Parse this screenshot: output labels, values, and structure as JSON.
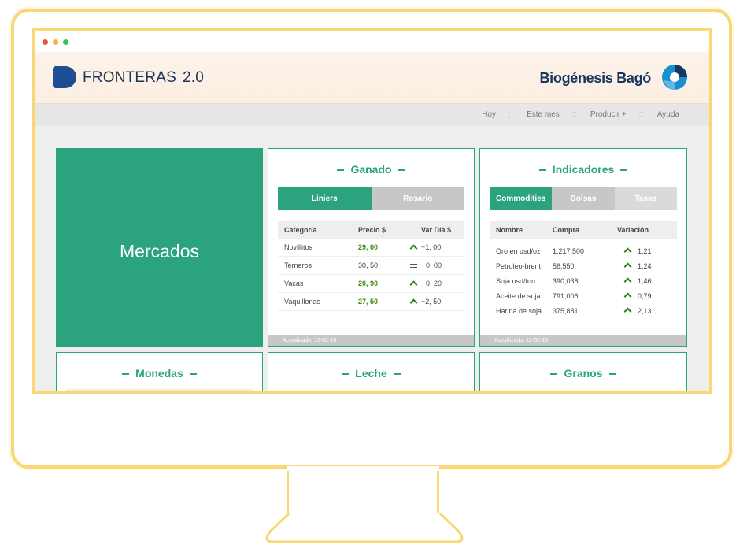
{
  "header": {
    "brand": "FRONTERAS",
    "version": "2.0",
    "partner": "Biogénesis Bagó"
  },
  "nav": [
    {
      "label": "Hoy"
    },
    {
      "label": "Este mes"
    },
    {
      "label": "Producir +"
    },
    {
      "label": "Ayuda"
    }
  ],
  "mercados": {
    "label": "Mercados"
  },
  "ganado": {
    "title": "Ganado",
    "tabs": [
      "Liniers",
      "Rosario"
    ],
    "columns": [
      "Categoría",
      "Precio $",
      "Var Día $"
    ],
    "rows": [
      {
        "cat": "Novillitos",
        "precio": "29, 00",
        "trend": "up",
        "var": "+1, 00"
      },
      {
        "cat": "Terneros",
        "precio": "30, 50",
        "trend": "equal",
        "var": "0, 00"
      },
      {
        "cat": "Vacas",
        "precio": "20, 90",
        "trend": "up",
        "var": "0, 20"
      },
      {
        "cat": "Vaquillonas",
        "precio": "27, 50",
        "trend": "up",
        "var": "+2, 50"
      }
    ],
    "updated": "Actualizado: 12-02-16"
  },
  "indicadores": {
    "title": "Indicadores",
    "tabs": [
      "Commodities",
      "Bolsas",
      "Tasas"
    ],
    "columns": [
      "Nombre",
      "Compra",
      "Variación"
    ],
    "rows": [
      {
        "nombre": "Oro en usd/oz",
        "compra": "1.217,500",
        "var": "1,21"
      },
      {
        "nombre": "Petroleo-brent",
        "compra": "56,550",
        "var": "1,24"
      },
      {
        "nombre": "Soja usd/ton",
        "compra": "390,038",
        "var": "1,46"
      },
      {
        "nombre": "Aceite de soja",
        "compra": "791,006",
        "var": "0,79"
      },
      {
        "nombre": "Harina de soja",
        "compra": "375,881",
        "var": "2,13"
      }
    ],
    "updated": "Actualizado: 12-02-16"
  },
  "monedas": {
    "title": "Monedas"
  },
  "leche": {
    "title": "Leche"
  },
  "granos": {
    "title": "Granos"
  },
  "colors": {
    "accent": "#2aa37e",
    "positive": "#3a8a12",
    "frame": "#f9d774"
  }
}
